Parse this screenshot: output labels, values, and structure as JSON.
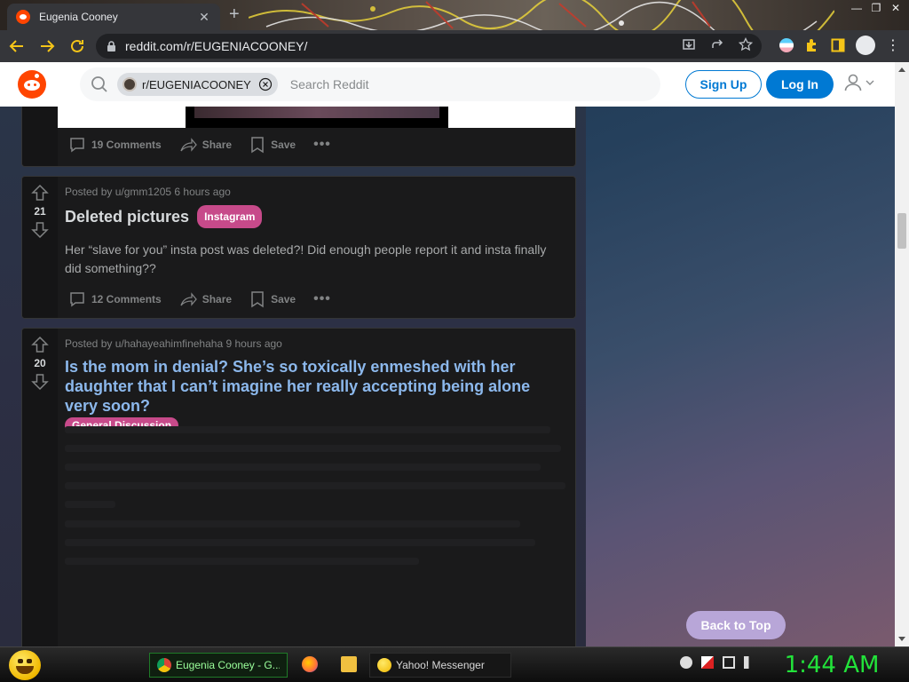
{
  "browser": {
    "tab_title": "Eugenia Cooney",
    "tab_close": "✕",
    "new_tab": "+",
    "url": "reddit.com/r/EUGENIACOONEY/"
  },
  "header": {
    "subreddit_chip": "r/EUGENIACOONEY",
    "search_placeholder": "Search Reddit",
    "signup_label": "Sign Up",
    "login_label": "Log In"
  },
  "posts": [
    {
      "comments": "19 Comments",
      "share": "Share",
      "save": "Save"
    },
    {
      "votes": "21",
      "meta": "Posted by u/gmm1205 6 hours ago",
      "title": "Deleted pictures",
      "flair": "Instagram",
      "text": "Her “slave for you” insta post was deleted?! Did enough people report it and insta finally did something??",
      "comments": "12 Comments",
      "share": "Share",
      "save": "Save"
    },
    {
      "votes": "20",
      "meta": "Posted by u/hahayeahimfinehaha 9 hours ago",
      "title": "Is the mom in denial? She’s so toxically enmeshed with her daughter that I can’t imagine her really accepting being alone very soon?",
      "flair": "General Discussion"
    }
  ],
  "back_to_top": "Back to Top",
  "taskbar": {
    "chrome_item": "Eugenia Cooney - G...",
    "yahoo_item": "Yahoo! Messenger",
    "clock": "1:44 AM"
  },
  "colors": {
    "reddit_orange": "#ff4500",
    "reddit_blue": "#0079d3",
    "flair_pink": "#c74a8a",
    "clock_green": "#22e33a"
  }
}
